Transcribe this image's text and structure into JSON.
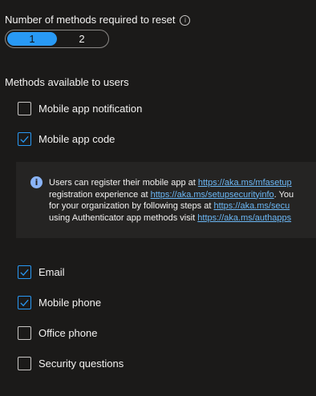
{
  "required_methods": {
    "label": "Number of methods required to reset",
    "info_icon": "info-icon",
    "options": [
      "1",
      "2"
    ],
    "selected": "1"
  },
  "methods": {
    "heading": "Methods available to users",
    "items": [
      {
        "label": "Mobile app notification",
        "checked": false
      },
      {
        "label": "Mobile app code",
        "checked": true
      },
      {
        "label": "Email",
        "checked": true
      },
      {
        "label": "Mobile phone",
        "checked": true
      },
      {
        "label": "Office phone",
        "checked": false
      },
      {
        "label": "Security questions",
        "checked": false
      }
    ]
  },
  "info_box": {
    "icon": "info-icon",
    "line1_text": "Users can register their mobile app at ",
    "line1_link": "https://aka.ms/mfasetup",
    "line2_text": "registration experience at ",
    "line2_link": "https://aka.ms/setupsecurityinfo",
    "line2_tail": ". You",
    "line3_text": "for your organization by following steps at ",
    "line3_link": "https://aka.ms/secu",
    "line4_text": "using Authenticator app methods visit ",
    "line4_link": "https://aka.ms/authapps"
  },
  "colors": {
    "accent": "#2899f5",
    "background": "#1b1a19",
    "link": "#6cb8f6"
  }
}
